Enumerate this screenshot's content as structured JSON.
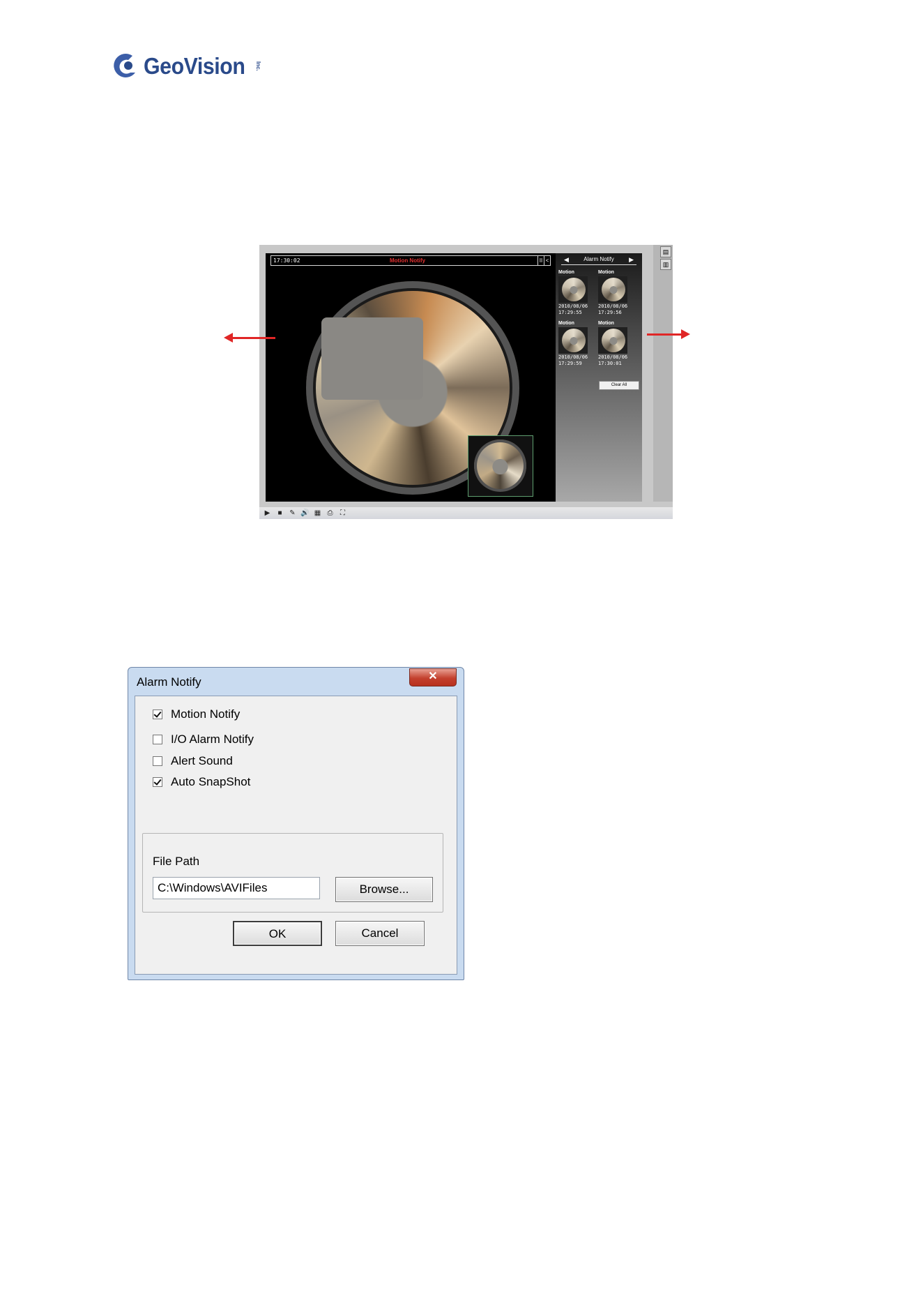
{
  "logo": {
    "text": "GeoVision",
    "inc": "Inc."
  },
  "viewer": {
    "status_time": "17:30:02",
    "status_title": "Motion Notify",
    "status_btn_pause": "II",
    "status_btn_collapse": "<",
    "alarm_panel": {
      "header": "Alarm Notify",
      "prev": "◀",
      "next": "▶",
      "items": [
        {
          "type": "Motion",
          "date": "2010/08/06",
          "time": "17:29:55"
        },
        {
          "type": "Motion",
          "date": "2010/08/06",
          "time": "17:29:56"
        },
        {
          "type": "Motion",
          "date": "2010/08/06",
          "time": "17:29:59"
        },
        {
          "type": "Motion",
          "date": "2010/08/06",
          "time": "17:30:01"
        }
      ],
      "clear_all": "Clear All"
    },
    "toolbar": [
      "▶",
      "■",
      "✎",
      "🔊",
      "▦",
      "⎙",
      "⛶"
    ],
    "right_bar": [
      "▤",
      "▥"
    ]
  },
  "dialog": {
    "title": "Alarm Notify",
    "close": "✕",
    "options": [
      {
        "label": "Motion Notify",
        "checked": true
      },
      {
        "label": "I/O Alarm Notify",
        "checked": false
      },
      {
        "label": "Alert Sound",
        "checked": false
      },
      {
        "label": "Auto SnapShot",
        "checked": true
      }
    ],
    "file_path_label": "File Path",
    "file_path_value": "C:\\Windows\\AVIFiles",
    "browse": "Browse...",
    "ok": "OK",
    "cancel": "Cancel"
  },
  "colors": {
    "accent_red": "#e02626",
    "logo_blue": "#2a4a8a"
  }
}
